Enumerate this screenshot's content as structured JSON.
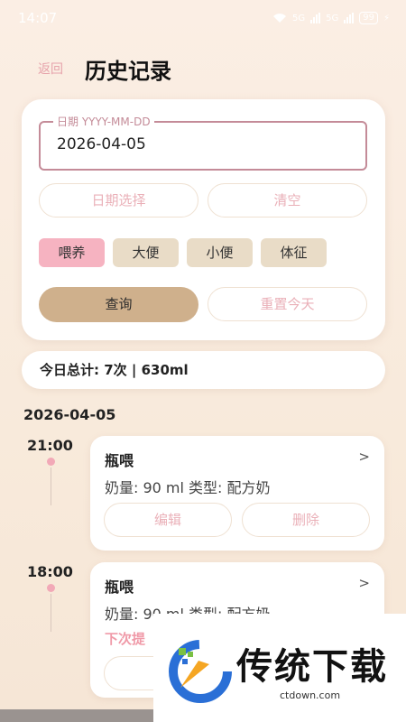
{
  "status_bar": {
    "time": "14:07",
    "signal_1": "5G",
    "signal_2": "5G",
    "battery": "99"
  },
  "header": {
    "back_label": "返回",
    "title": "历史记录"
  },
  "filter": {
    "date_label": "日期 YYYY-MM-DD",
    "date_value": "2026-04-05",
    "pick_date_label": "日期选择",
    "clear_label": "清空",
    "tags": [
      {
        "label": "喂养",
        "active": true
      },
      {
        "label": "大便",
        "active": false
      },
      {
        "label": "小便",
        "active": false
      },
      {
        "label": "体征",
        "active": false
      }
    ],
    "query_label": "查询",
    "reset_label": "重置今天"
  },
  "summary": {
    "text": "今日总计: 7次 | 630ml"
  },
  "date_heading": "2026-04-05",
  "records": [
    {
      "time": "21:00",
      "title": "瓶喂",
      "arrow": ">",
      "detail": "奶量: 90 ml  类型: 配方奶",
      "edit_label": "编辑",
      "delete_label": "删除"
    },
    {
      "time": "18:00",
      "title": "瓶喂",
      "arrow": ">",
      "detail": "奶量: 90 ml  类型: 配方奶",
      "remind": "下次提"
    }
  ],
  "watermark": {
    "text": "传统下载",
    "url": "ctdown.com"
  },
  "colors": {
    "accent_pink": "#f6b3c1",
    "chip_beige": "#e9dcc7",
    "query_tan": "#cfb08c",
    "outline_pink": "#c48b98"
  }
}
